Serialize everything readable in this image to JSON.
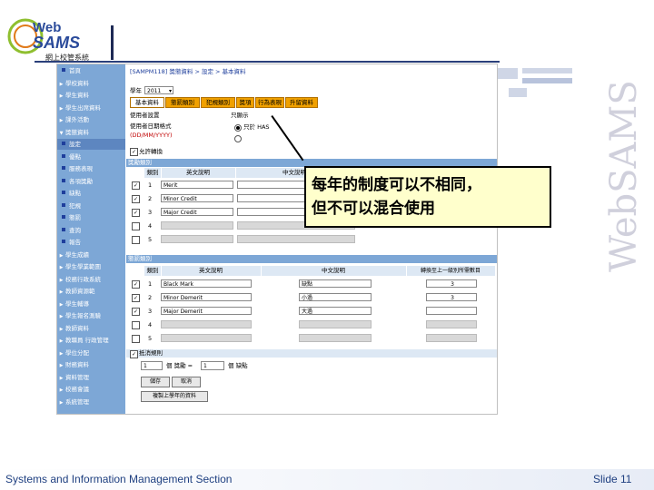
{
  "logo": {
    "web": "Web",
    "sams": "SAMS",
    "subtitle": "網上校管系統"
  },
  "sidebar": [
    {
      "label": "首頁",
      "kind": "dot"
    },
    {
      "label": "學校資料",
      "kind": "arrow"
    },
    {
      "label": "學生資料",
      "kind": "arrow"
    },
    {
      "label": "學生出席資料",
      "kind": "arrow"
    },
    {
      "label": "課外活動",
      "kind": "arrow"
    },
    {
      "label": "獎懲資料",
      "kind": "open"
    },
    {
      "label": "設定",
      "kind": "dot",
      "selected": true
    },
    {
      "label": "優點",
      "kind": "dot"
    },
    {
      "label": "服務表現",
      "kind": "dot"
    },
    {
      "label": "各項獎勵",
      "kind": "dot"
    },
    {
      "label": "缺點",
      "kind": "dot"
    },
    {
      "label": "犯規",
      "kind": "dot"
    },
    {
      "label": "懲罰",
      "kind": "dot"
    },
    {
      "label": "查詢",
      "kind": "dot"
    },
    {
      "label": "報告",
      "kind": "dot"
    },
    {
      "label": "學生成績",
      "kind": "arrow"
    },
    {
      "label": "學生學業範圍",
      "kind": "arrow"
    },
    {
      "label": "校務行政系統",
      "kind": "arrow"
    },
    {
      "label": "教師資源範",
      "kind": "arrow"
    },
    {
      "label": "學生輔導",
      "kind": "arrow"
    },
    {
      "label": "學生報名測驗",
      "kind": "arrow"
    },
    {
      "label": "教師資料",
      "kind": "arrow"
    },
    {
      "label": "教職員 行政管理",
      "kind": "arrow"
    },
    {
      "label": "學位分配",
      "kind": "arrow"
    },
    {
      "label": "財務資料",
      "kind": "arrow"
    },
    {
      "label": "資料管理",
      "kind": "arrow"
    },
    {
      "label": "校務會議",
      "kind": "arrow"
    },
    {
      "label": "系統管理",
      "kind": "arrow"
    }
  ],
  "main": {
    "breadcrumb": "[SAMPM118] 獎懲資料 > 設定 > 基本資料",
    "year_label": "學年",
    "year_value": "2011",
    "tabs": [
      {
        "label": "基本資料",
        "active": true
      },
      {
        "label": "懲罰類別"
      },
      {
        "label": "犯規類別"
      },
      {
        "label": "獎項"
      },
      {
        "label": "行為表現"
      },
      {
        "label": "升留資料"
      }
    ],
    "pref_label": "使用者設置",
    "pref_value": "只顯示",
    "date_format_label": "使用者日期格式",
    "date_format": "(DD/MM/YYYY)",
    "option_text": "只於 HAS",
    "allow_convert": "允許轉換",
    "merit_section": "獎勵類別",
    "demerit_section": "懲罰類別",
    "merit_headers": [
      "類別",
      "英文說明",
      "中文說明"
    ],
    "merit_rows": [
      {
        "checked": true,
        "num": "1",
        "en": "Merit"
      },
      {
        "checked": true,
        "num": "2",
        "en": "Minor Credit"
      },
      {
        "checked": true,
        "num": "3",
        "en": "Major Credit"
      },
      {
        "checked": false,
        "num": "4",
        "en": ""
      },
      {
        "checked": false,
        "num": "5",
        "en": ""
      }
    ],
    "demerit_headers": [
      "類別",
      "英文說明",
      "中文說明",
      "轉換至上一級別所需數目"
    ],
    "demerit_rows": [
      {
        "checked": true,
        "num": "1",
        "en": "Black Mark",
        "zh": "缺點",
        "count": "3"
      },
      {
        "checked": true,
        "num": "2",
        "en": "Minor Demerit",
        "zh": "小過",
        "count": "3"
      },
      {
        "checked": true,
        "num": "3",
        "en": "Major Demerit",
        "zh": "大過",
        "count": ""
      },
      {
        "checked": false,
        "num": "4",
        "en": "",
        "zh": "",
        "count": ""
      },
      {
        "checked": false,
        "num": "5",
        "en": "",
        "zh": "",
        "count": ""
      }
    ],
    "convert_label": "抵消規則",
    "convert_text_a": "1",
    "convert_mid": "個 獎勵 =",
    "convert_text_b": "1",
    "convert_tail": "個 缺點",
    "save_label": "儲存",
    "cancel_label": "取消",
    "copy_label": "複製上學年的資料"
  },
  "callout": {
    "line1": "每年的制度可以不相同，",
    "line2": "但不可以混合使用"
  },
  "watermark": "WebSAMS",
  "footer": {
    "left": "Systems and Information Management Section",
    "right": "Slide 11"
  }
}
